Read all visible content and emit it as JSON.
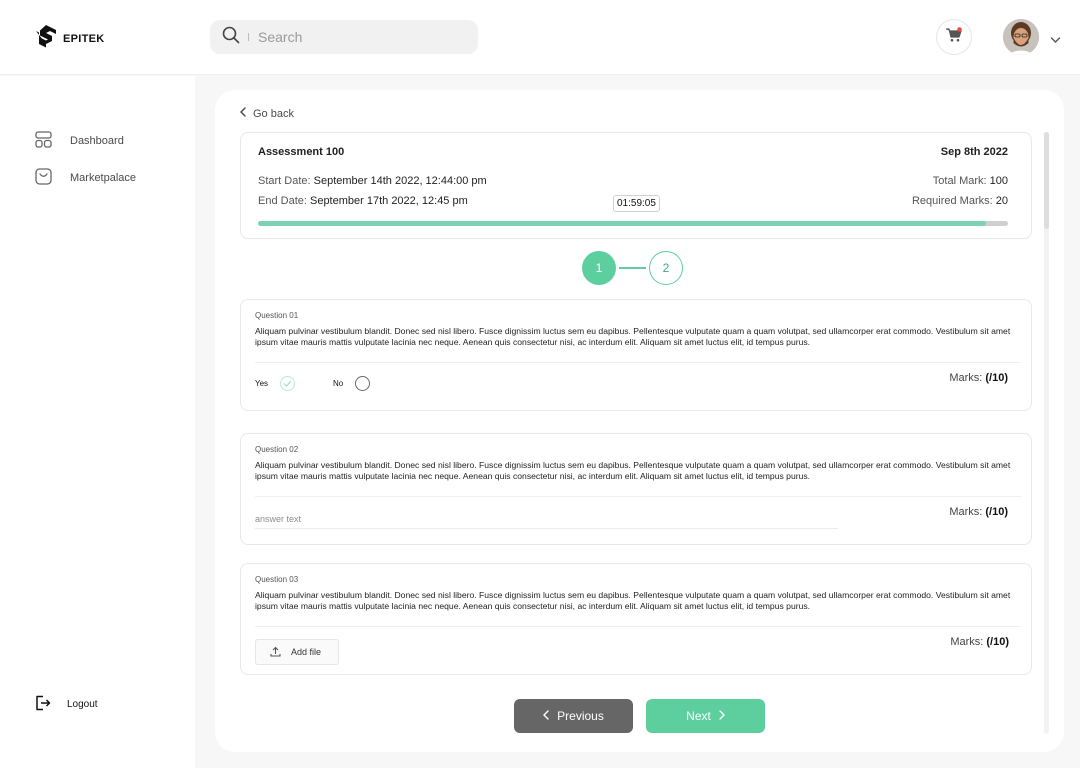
{
  "brand": {
    "name": "EPITEK"
  },
  "search": {
    "placeholder": "Search"
  },
  "sidebar": {
    "items": [
      {
        "label": "Dashboard",
        "icon": "dashboard-icon"
      },
      {
        "label": "Marketpalace",
        "icon": "marketplace-icon"
      }
    ],
    "logout": "Logout"
  },
  "nav": {
    "go_back": "Go back"
  },
  "assessment": {
    "title": "Assessment 100",
    "date": "Sep 8th 2022",
    "start_label": "Start Date:",
    "start_value": "September 14th 2022, 12:44:00 pm",
    "end_label": "End Date:",
    "end_value": "September 17th 2022, 12:45 pm",
    "total_label": "Total Mark:",
    "total_value": "100",
    "required_label": "Required Marks:",
    "required_value": "20",
    "timer": "01:59:05",
    "progress_fraction": 0.97
  },
  "steps": [
    "1",
    "2"
  ],
  "active_step": 1,
  "questions": [
    {
      "label": "Question 01",
      "text": "Aliquam pulvinar vestibulum blandit. Donec sed nisl libero. Fusce dignissim luctus sem eu dapibus. Pellentesque vulputate quam a quam volutpat, sed ullamcorper erat commodo. Vestibulum sit amet ipsum vitae mauris mattis vulputate lacinia nec neque. Aenean quis consectetur nisi, ac interdum elit. Aliquam sit amet luctus elit, id tempus purus.",
      "marks_label": "Marks:",
      "marks_value": "(/10)",
      "options": [
        "Yes",
        "No"
      ],
      "selected": "Yes"
    },
    {
      "label": "Question 02",
      "text": "Aliquam pulvinar vestibulum blandit. Donec sed nisl libero. Fusce dignissim luctus sem eu dapibus. Pellentesque vulputate quam a quam volutpat, sed ullamcorper erat commodo. Vestibulum sit amet ipsum vitae mauris mattis vulputate lacinia nec neque. Aenean quis consectetur nisi, ac interdum elit. Aliquam sit amet luctus elit, id tempus purus.",
      "marks_label": "Marks:",
      "marks_value": "(/10)",
      "answer_placeholder": "answer text"
    },
    {
      "label": "Question 03",
      "text": "Aliquam pulvinar vestibulum blandit. Donec sed nisl libero. Fusce dignissim luctus sem eu dapibus. Pellentesque vulputate quam a quam volutpat, sed ullamcorper erat commodo. Vestibulum sit amet ipsum vitae mauris mattis vulputate lacinia nec neque. Aenean quis consectetur nisi, ac interdum elit. Aliquam sit amet luctus elit, id tempus purus.",
      "marks_label": "Marks:",
      "marks_value": "(/10)",
      "add_file": "Add file"
    }
  ],
  "buttons": {
    "previous": "Previous",
    "next": "Next"
  },
  "colors": {
    "accent": "#5dcf9f",
    "progress": "#7bd3b4",
    "secondary_button": "#666666"
  }
}
